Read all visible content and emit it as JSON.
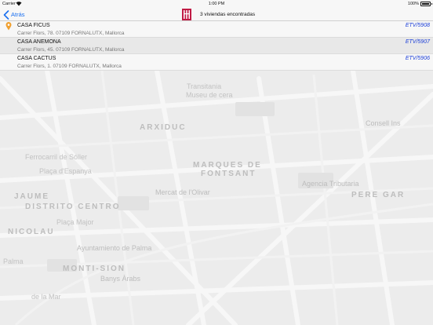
{
  "status_bar": {
    "carrier": "Carrier",
    "time": "1:00 PM",
    "battery": "100%"
  },
  "nav": {
    "back_label": "Atrás",
    "title": "3 viviendas encontradas",
    "back_icon": "chevron-left-icon",
    "logo_icon": "brand-logo"
  },
  "colors": {
    "accent": "#1a6ff0",
    "code": "#1a3dd8",
    "pin": "#f0a030",
    "logo": "#c01a44"
  },
  "listings": [
    {
      "name": "CASA FICUS",
      "address": "Carrer Flors, 78. 07109 FORNALUTX, Mallorca",
      "code": "ETV/5908"
    },
    {
      "name": "CASA ANEMONA",
      "address": "Carrer Flors, 45. 07109 FORNALUTX, Mallorca",
      "code": "ETV/5907"
    },
    {
      "name": "CASA CACTUS",
      "address": "Carrer Flors, 1. 07109 FORNALUTX, Mallorca",
      "code": "ETV/5906"
    }
  ],
  "map": {
    "labels": [
      "Transitania",
      "Museu de cera",
      "ARXIDUC",
      "Consell Ins",
      "Ferrocarril de Sóller",
      "Plaça d'Espanya",
      "MARQUES DE",
      "FONTSANT",
      "Agencia Tributaria",
      "PERE GAR",
      "Mercat de l'Olivar",
      "JAUME",
      "DISTRITO CENTRO",
      "Plaça Major",
      "NICOLAU",
      "Palma",
      "Ayuntamiento de Palma",
      "MONTI-SION",
      "Banys Àrabs",
      "de la Mar"
    ]
  }
}
